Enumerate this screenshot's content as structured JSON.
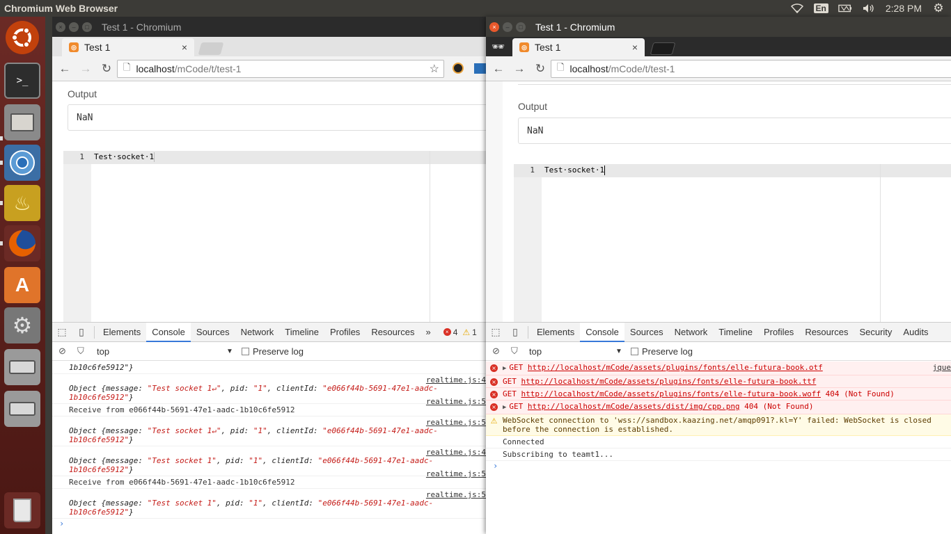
{
  "top_panel": {
    "app_title": "Chromium Web Browser",
    "keyboard_layout": "En",
    "clock": "2:28 PM"
  },
  "launcher": {
    "items": [
      "ubuntu-dash",
      "terminal",
      "files",
      "chromium",
      "genie-lamp",
      "firefox",
      "software-center",
      "system-settings",
      "drive-1",
      "drive-2",
      "trash"
    ]
  },
  "left_window": {
    "title": "Test 1 - Chromium",
    "tab_label": "Test 1",
    "url_host": "localhost",
    "url_path": "/mCode/t/test-1",
    "output_label": "Output",
    "output_value": "NaN",
    "editor_line_number": "1",
    "editor_code": "Test·socket·1",
    "devtools": {
      "tabs": [
        "Elements",
        "Console",
        "Sources",
        "Network",
        "Timeline",
        "Profiles",
        "Resources"
      ],
      "more": "»",
      "error_count": "4",
      "warning_count": "1",
      "context": "top",
      "preserve_log": "Preserve log",
      "messages": [
        {
          "kind": "tail",
          "text": "1b10c6fe5912\"}"
        },
        {
          "kind": "object",
          "src": "realtime.js:4",
          "parts": [
            "Object {",
            "message: ",
            "\"Test socket 1↵\"",
            ", pid: ",
            "\"1\"",
            ", clientId: ",
            "\"e066f44b-5691-47e1-aadc-",
            "1b10c6fe5912\"",
            "}"
          ]
        },
        {
          "kind": "text",
          "src": "realtime.js:5",
          "text": "Receive from e066f44b-5691-47e1-aadc-1b10c6fe5912"
        },
        {
          "kind": "object",
          "src": "realtime.js:5",
          "parts": [
            "Object {",
            "message: ",
            "\"Test socket 1↵\"",
            ", pid: ",
            "\"1\"",
            ", clientId: ",
            "\"e066f44b-5691-47e1-aadc-",
            "1b10c6fe5912\"",
            "}"
          ]
        },
        {
          "kind": "object",
          "src": "realtime.js:4",
          "parts": [
            "Object {",
            "message: ",
            "\"Test socket 1\"",
            ", pid: ",
            "\"1\"",
            ", clientId: ",
            "\"e066f44b-5691-47e1-aadc-",
            "1b10c6fe5912\"",
            "}"
          ]
        },
        {
          "kind": "text",
          "src": "realtime.js:5",
          "text": "Receive from e066f44b-5691-47e1-aadc-1b10c6fe5912"
        },
        {
          "kind": "object",
          "src": "realtime.js:5",
          "parts": [
            "Object {",
            "message: ",
            "\"Test socket 1\"",
            ", pid: ",
            "\"1\"",
            ", clientId: ",
            "\"e066f44b-5691-47e1-aadc-",
            "1b10c6fe5912\"",
            "}"
          ]
        }
      ],
      "prompt": "›"
    }
  },
  "right_window": {
    "title": "Test 1 - Chromium",
    "tab_label": "Test 1",
    "url_host": "localhost",
    "url_path": "/mCode/t/test-1",
    "output_label": "Output",
    "output_value": "NaN",
    "editor_line_number": "1",
    "editor_code": "Test·socket·1",
    "devtools": {
      "tabs": [
        "Elements",
        "Console",
        "Sources",
        "Network",
        "Timeline",
        "Profiles",
        "Resources",
        "Security",
        "Audits"
      ],
      "context": "top",
      "preserve_log": "Preserve log",
      "messages": [
        {
          "kind": "error",
          "method": "GET",
          "url": "http://localhost/mCode/assets/plugins/fonts/elle-futura-book.otf",
          "suffix": "",
          "expandable": true,
          "src": "jque"
        },
        {
          "kind": "error",
          "method": "GET",
          "url": "http://localhost/mCode/assets/plugins/fonts/elle-futura-book.ttf",
          "suffix": "",
          "expandable": false,
          "src": ""
        },
        {
          "kind": "error",
          "method": "GET",
          "url": "http://localhost/mCode/assets/plugins/fonts/elle-futura-book.woff",
          "suffix": " 404 (Not Found)",
          "expandable": false,
          "src": ""
        },
        {
          "kind": "error",
          "method": "GET",
          "url": "http://localhost/mCode/assets/dist/img/cpp.png",
          "suffix": " 404 (Not Found)",
          "expandable": true,
          "src": ""
        },
        {
          "kind": "warn",
          "line1": "WebSocket connection to 'wss://sandbox.kaazing.net/amqp091?.kl=Y' failed: WebSocket is closed",
          "line2": "before the connection is established."
        },
        {
          "kind": "text",
          "text": "Connected"
        },
        {
          "kind": "text",
          "text": "Subscribing to teamt1..."
        }
      ],
      "prompt": "›"
    }
  }
}
